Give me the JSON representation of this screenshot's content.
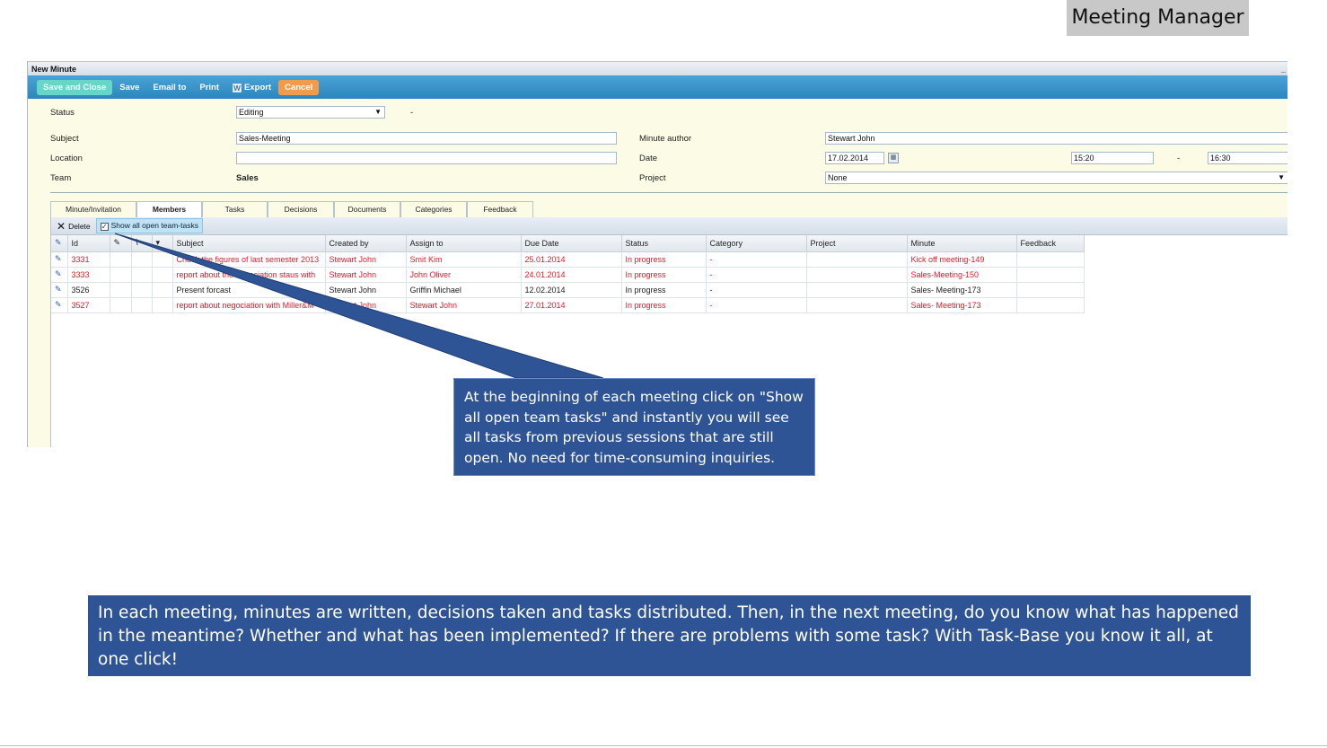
{
  "slide": {
    "title": "Meeting Manager",
    "callout_text": "At the beginning of each meeting click on \"Show all open team tasks\" and instantly you will see all tasks from previous sessions that are still open. No need for time-consuming inquiries.",
    "banner_line1": "In each meeting, minutes are written, decisions taken and tasks distributed. Then, in the next meeting, do you know what has happened",
    "banner_line2": "in the meantime? Whether and what has been implemented? If there are problems with some task? With Task-Base you know it all, at one click!",
    "accent_color": "#2f5496"
  },
  "window": {
    "title": "New Minute",
    "minimize": "_"
  },
  "toolbar": {
    "save_close": "Save and Close",
    "save": "Save",
    "email": "Email to",
    "print": "Print",
    "export": "Export",
    "export_icon": "W",
    "cancel": "Cancel"
  },
  "form": {
    "status_label": "Status",
    "status_value": "Editing",
    "status_dash": "-",
    "subject_label": "Subject",
    "subject_value": "Sales-Meeting",
    "location_label": "Location",
    "location_value": "",
    "team_label": "Team",
    "team_value": "Sales",
    "author_label": "Minute author",
    "author_value": "Stewart John",
    "date_label": "Date",
    "date_value": "17.02.2014",
    "time_start": "15:20",
    "time_sep": "-",
    "time_end": "16:30",
    "project_label": "Project",
    "project_value": "None"
  },
  "tabs": [
    {
      "label": "Minute/Invitation"
    },
    {
      "label": "Members"
    },
    {
      "label": "Tasks"
    },
    {
      "label": "Decisions"
    },
    {
      "label": "Documents"
    },
    {
      "label": "Categories"
    },
    {
      "label": "Feedback"
    }
  ],
  "grid_toolbar": {
    "delete": "Delete",
    "show_all": "Show all open team-tasks",
    "checkmark": "✓"
  },
  "columns": [
    "Id",
    "Subject",
    "Created by",
    "Assign to",
    "Due Date",
    "Status",
    "Category",
    "Project",
    "Minute",
    "Feedback"
  ],
  "rows": [
    {
      "id": "3331",
      "subject": "Check the figures of last semester 2013",
      "created": "Stewart John",
      "assign": "Smit Kim",
      "due": "25.01.2014",
      "status": "In progress",
      "category": "-",
      "project": "",
      "minute": "Kick off meeting-149",
      "feedback": "",
      "overdue": true
    },
    {
      "id": "3333",
      "subject": "report about the negociation staus with",
      "created": "Stewart John",
      "assign": "John Oliver",
      "due": "24.01.2014",
      "status": "In progress",
      "category": "-",
      "project": "",
      "minute": "Sales-Meeting-150",
      "feedback": "",
      "overdue": true
    },
    {
      "id": "3526",
      "subject": "Present forcast",
      "created": "Stewart John",
      "assign": "Griffin Michael",
      "due": "12.02.2014",
      "status": "In progress",
      "category": "-",
      "project": "",
      "minute": "Sales- Meeting-173",
      "feedback": "",
      "overdue": false
    },
    {
      "id": "3527",
      "subject": "report about negociation with Miller&M",
      "created": "Stewart John",
      "assign": "Stewart John",
      "due": "27.01.2014",
      "status": "In progress",
      "category": "-",
      "project": "",
      "minute": "Sales- Meeting-173",
      "feedback": "",
      "overdue": true
    }
  ]
}
